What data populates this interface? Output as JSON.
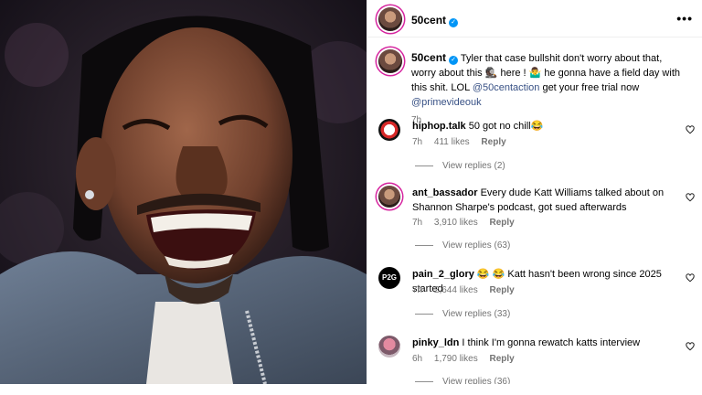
{
  "post": {
    "username": "50cent",
    "more_icon": "more-horizontal-icon",
    "caption_user": "50cent",
    "caption_text_1": " Tyler that case bullshit don't worry about that, worry about this 🕵🏿 here ! 🤷‍♂️ he gonna have a field day with this shit. LOL ",
    "caption_mention_1": "@50centaction",
    "caption_text_2": " get your free trial now ",
    "caption_mention_2": "@primevideouk",
    "time": "7h"
  },
  "comments": [
    {
      "user": "hiphop.talk",
      "text": " 50 got no chill😂",
      "time": "7h",
      "likes": "411 likes",
      "reply": "Reply",
      "view_replies": "View replies (2)"
    },
    {
      "user": "ant_bassador",
      "text": " Every dude Katt Williams talked about on Shannon Sharpe's podcast, got sued afterwards",
      "time": "7h",
      "likes": "3,910 likes",
      "reply": "Reply",
      "view_replies": "View replies (63)"
    },
    {
      "user": "pain_2_glory",
      "text": " 😂 😂 Katt hasn't been wrong since 2025 started",
      "time": "7h",
      "likes": "2,644 likes",
      "reply": "Reply",
      "view_replies": "View replies (33)"
    },
    {
      "user": "pinky_ldn",
      "text": " I think I'm gonna rewatch katts interview",
      "time": "6h",
      "likes": "1,790 likes",
      "reply": "Reply",
      "view_replies": "View replies (36)"
    }
  ],
  "colors": {
    "link": "#385185",
    "verified": "#0095f6",
    "meta": "#737373"
  }
}
